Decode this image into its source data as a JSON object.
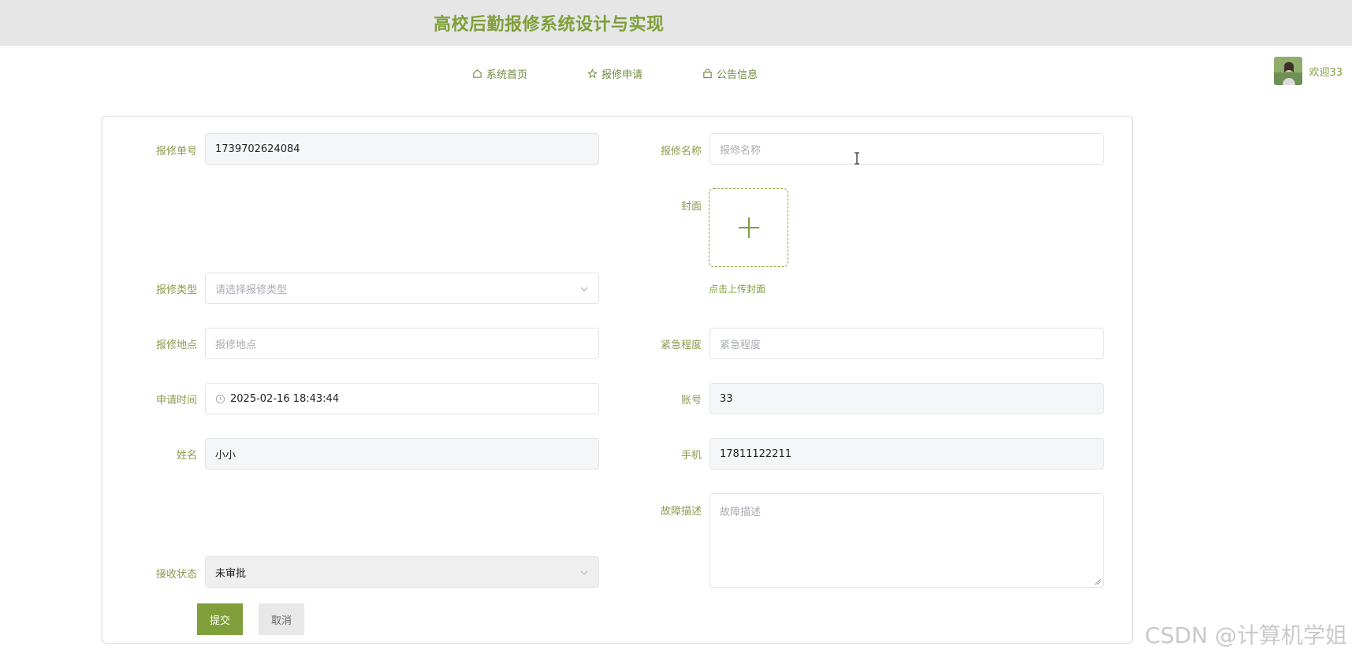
{
  "header": {
    "title": "高校后勤报修系统设计与实现"
  },
  "nav": {
    "items": [
      {
        "label": "系统首页",
        "icon": "home-icon"
      },
      {
        "label": "报修申请",
        "icon": "star-icon"
      },
      {
        "label": "公告信息",
        "icon": "bag-icon"
      }
    ]
  },
  "user": {
    "welcome": "欢迎33"
  },
  "form": {
    "order_no": {
      "label": "报修单号",
      "value": "1739702624084"
    },
    "repair_name": {
      "label": "报修名称",
      "placeholder": "报修名称"
    },
    "cover": {
      "label": "封面",
      "tip": "点击上传封面"
    },
    "repair_type": {
      "label": "报修类型",
      "placeholder": "请选择报修类型"
    },
    "location": {
      "label": "报修地点",
      "placeholder": "报修地点"
    },
    "urgency": {
      "label": "紧急程度",
      "placeholder": "紧急程度"
    },
    "apply_time": {
      "label": "申请时间",
      "value": "2025-02-16 18:43:44"
    },
    "account": {
      "label": "账号",
      "value": "33"
    },
    "name": {
      "label": "姓名",
      "value": "小小"
    },
    "phone": {
      "label": "手机",
      "value": "17811122211"
    },
    "fault_desc": {
      "label": "故障描述",
      "placeholder": "故障描述"
    },
    "receive_status": {
      "label": "接收状态",
      "value": "未审批"
    },
    "submit_label": "提交",
    "cancel_label": "取消"
  },
  "watermark": "CSDN @计算机学姐",
  "colors": {
    "accent": "#7f9f3a",
    "label": "#8a9a4e",
    "topbar": "#e6e6e6"
  }
}
